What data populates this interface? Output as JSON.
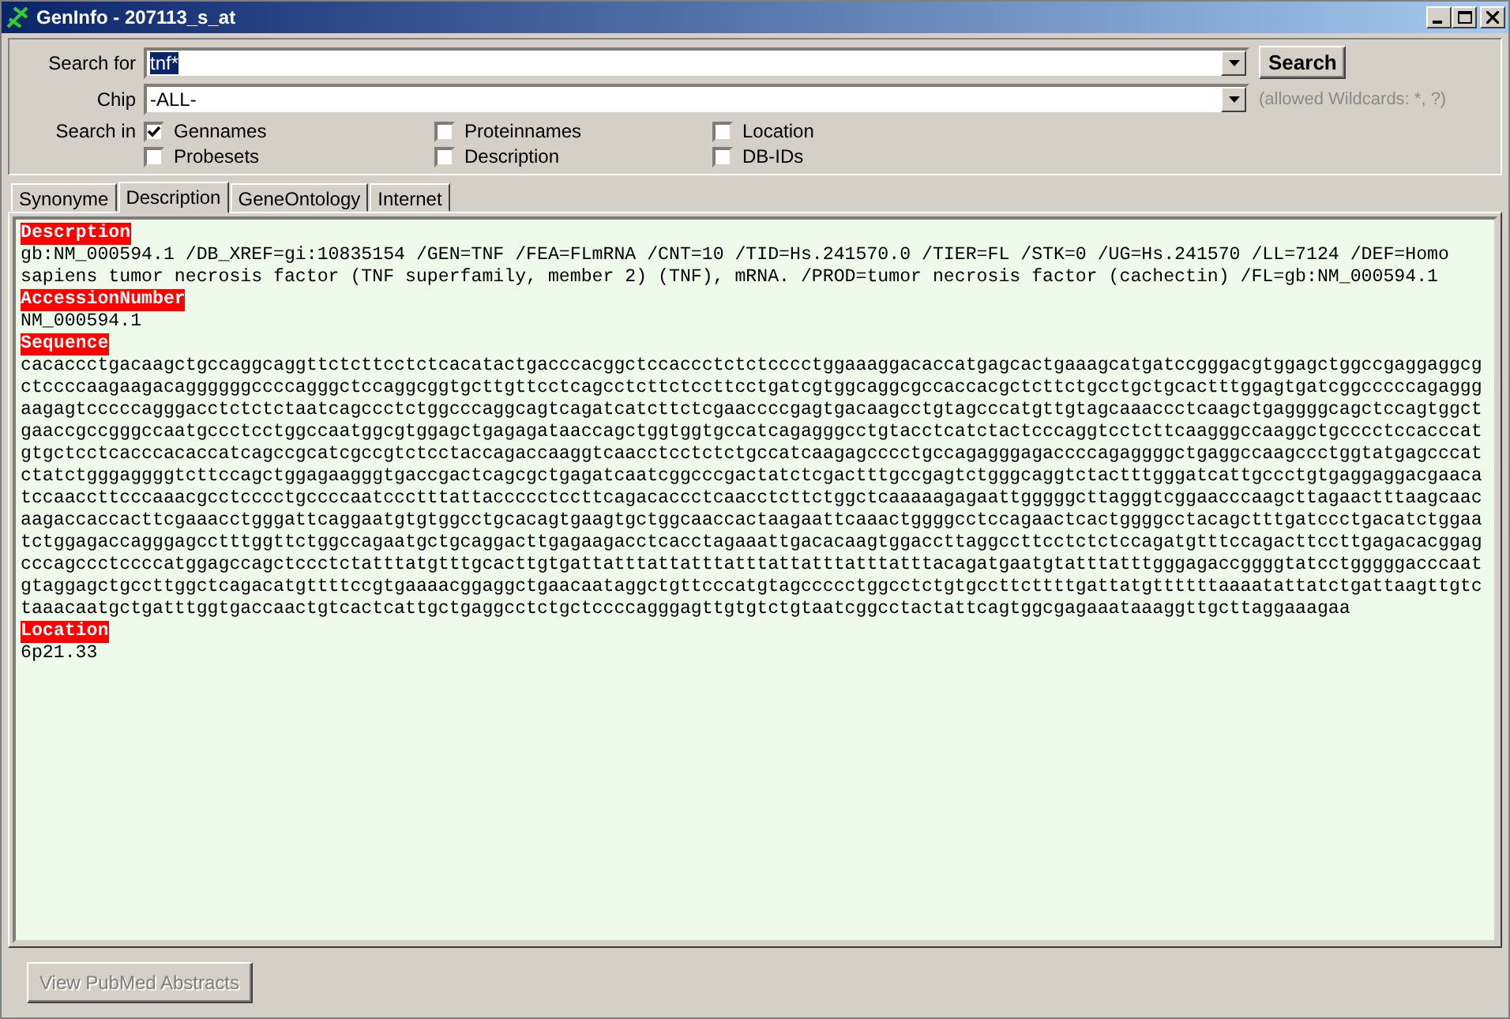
{
  "window": {
    "title": "GenInfo - 207113_s_at"
  },
  "search": {
    "label": "Search for",
    "value": "tnf*",
    "highlighted": true,
    "button": "Search"
  },
  "chip": {
    "label": "Chip",
    "value": "-ALL-",
    "hint": "(allowed Wildcards: *, ?)"
  },
  "search_in": {
    "label": "Search in",
    "options": [
      {
        "label": "Gennames",
        "checked": true
      },
      {
        "label": "Proteinnames",
        "checked": false
      },
      {
        "label": "Location",
        "checked": false
      },
      {
        "label": "Probesets",
        "checked": false
      },
      {
        "label": "Description",
        "checked": false
      },
      {
        "label": "DB-IDs",
        "checked": false
      }
    ]
  },
  "tabs": [
    {
      "label": "Synonyme",
      "selected": false
    },
    {
      "label": "Description",
      "selected": true
    },
    {
      "label": "GeneOntology",
      "selected": false
    },
    {
      "label": "Internet",
      "selected": false
    }
  ],
  "sections": [
    {
      "heading": "Descrption",
      "kind": "text",
      "text": "gb:NM_000594.1 /DB_XREF=gi:10835154 /GEN=TNF /FEA=FLmRNA /CNT=10 /TID=Hs.241570.0 /TIER=FL /STK=0 /UG=Hs.241570 /LL=7124 /DEF=Homo sapiens tumor necrosis factor (TNF superfamily, member 2) (TNF), mRNA. /PROD=tumor necrosis factor (cachectin) /FL=gb:NM_000594.1"
    },
    {
      "heading": "AccessionNumber",
      "kind": "text",
      "text": "NM_000594.1"
    },
    {
      "heading": "Sequence",
      "kind": "sequence",
      "text": "cacaccctgacaagctgccaggcaggttctcttcctctcacatactgacccacggctccaccctctctcccctggaaaggacaccatgagcactgaaagcatgatccgggacgtggagctggccgaggaggcgctccccaagaagacaggggggccccagggctccaggcggtgcttgttcctcagcctcttctccttcctgatcgtggcaggcgccaccacgctcttctgcctgctgcactttggagtgatcggcccccagagggaagagtcccccagggacctctctctaatcagccctctggcccaggcagtcagatcatcttctcgaaccccgagtgacaagcctgtagcccatgttgtagcaaaccctcaagctgaggggcagctccagtggctgaaccgccgggccaatgccctcctggccaatggcgtggagctgagagataaccagctggtggtgccatcagagggcctgtacctcatctactcccaggtcctcttcaagggccaaggctgcccctccacccatgtgctcctcacccacaccatcagccgcatcgccgtctcctaccagaccaaggtcaacctcctctctgccatcaagagcccctgccagagggagaccccagaggggctgaggccaagccctggtatgagcccatctatctgggaggggtcttccagctggagaagggtgaccgactcagcgctgagatcaatcggcccgactatctcgactttgccgagtctgggcaggtctactttgggatcattgccctgtgaggaggacgaacatccaaccttcccaaacgcctcccctgccccaatccctttattaccccctccttcagacaccctcaacctcttctggctcaaaaagagaattgggggcttagggtcggaacccaagcttagaactttaagcaacaagaccaccacttcgaaacctgggattcaggaatgtgtggcctgcacagtgaagtgctggcaaccactaagaattcaaactggggcctccagaactcactggggcctacagctttgatccctgacatctggaatctggagaccagggagcctttggttctggccagaatgctgcaggacttgagaagacctcacctagaaattgacacaagtggaccttaggccttcctctctccagatgtttccagacttccttgagacacggagcccagccctccccatggagccagctccctctatttatgtttgcacttgtgattatttattatttatttattatttatttatttacagatgaatgtatttatttgggagaccggggtatcctgggggacccaatgtaggagctgccttggctcagacatgttttccgtgaaaacggaggctgaacaataggctgttcccatgtagccccctggcctctgtgccttcttttgattatgttttttaaaatattatctgattaagttgtctaaacaatgctgatttggtgaccaactgtcactcattgctgaggcctctgctccccagggagttgtgtctgtaatcggcctactattcagtggcgagaaataaaggttgcttaggaaagaa"
    },
    {
      "heading": "Location",
      "kind": "text",
      "text": "6p21.33"
    }
  ],
  "footer_button": {
    "label": "View PubMed Abstracts",
    "disabled": true
  }
}
